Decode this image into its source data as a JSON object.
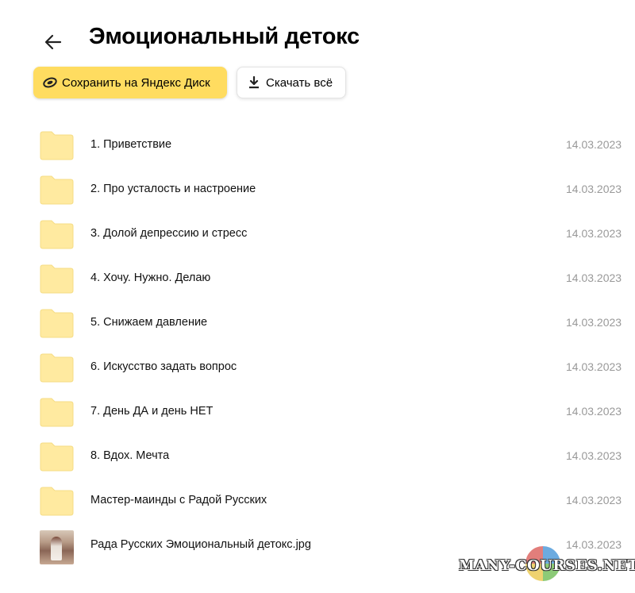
{
  "header": {
    "title": "Эмоциональный детокс",
    "back_icon": "arrow-left-icon"
  },
  "toolbar": {
    "save_label": "Сохранить на Яндекс Диск",
    "download_label": "Скачать всё",
    "save_icon": "yandex-disk-icon",
    "download_icon": "download-icon",
    "accent_color": "#ffdc60"
  },
  "files": [
    {
      "name": "1. Приветствие",
      "date": "14.03.2023",
      "type": "folder"
    },
    {
      "name": "2. Про усталость и настроение",
      "date": "14.03.2023",
      "type": "folder"
    },
    {
      "name": "3. Долой депрессию и стресс",
      "date": "14.03.2023",
      "type": "folder"
    },
    {
      "name": "4. Хочу. Нужно. Делаю",
      "date": "14.03.2023",
      "type": "folder"
    },
    {
      "name": "5. Снижаем давление",
      "date": "14.03.2023",
      "type": "folder"
    },
    {
      "name": "6. Искусство задать вопрос",
      "date": "14.03.2023",
      "type": "folder"
    },
    {
      "name": "7. День ДА и день НЕТ",
      "date": "14.03.2023",
      "type": "folder"
    },
    {
      "name": "8. Вдох. Мечта",
      "date": "14.03.2023",
      "type": "folder"
    },
    {
      "name": "Мастер-маинды с Радой Русских",
      "date": "14.03.2023",
      "type": "folder"
    },
    {
      "name": "Рада Русских Эмоциональный детокс.jpg",
      "date": "14.03.2023",
      "type": "image"
    }
  ],
  "folder_color": "#ffeaa0",
  "watermark": "MANY-COURSES.NET"
}
